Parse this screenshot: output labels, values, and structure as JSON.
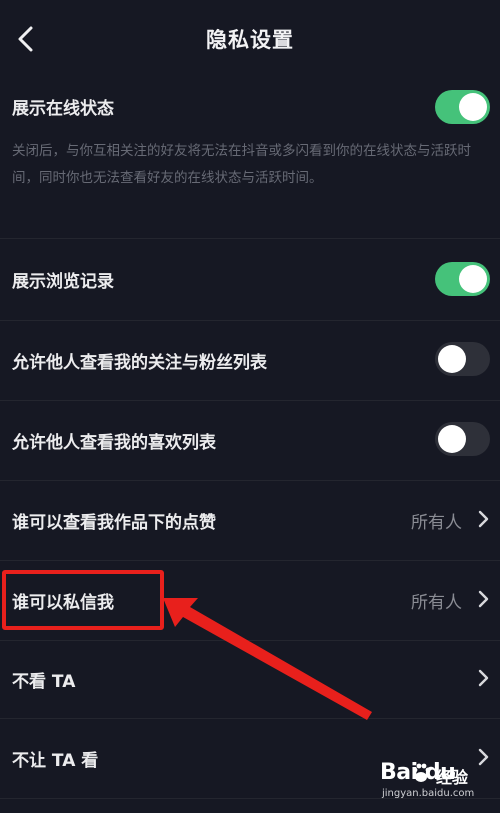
{
  "header": {
    "title": "隐私设置"
  },
  "rows": [
    {
      "label": "展示在线状态",
      "description": "关闭后，与你互相关注的好友将无法在抖音或多闪看到你的在线状态与活跃时间，同时你也无法查看好友的在线状态与活跃时间。",
      "toggle": true
    },
    {
      "label": "展示浏览记录",
      "toggle": true
    },
    {
      "label": "允许他人查看我的关注与粉丝列表",
      "toggle": false
    },
    {
      "label": "允许他人查看我的喜欢列表",
      "toggle": false
    },
    {
      "label": "谁可以查看我作品下的点赞",
      "value": "所有人"
    },
    {
      "label": "谁可以私信我",
      "value": "所有人"
    },
    {
      "label": "不看 TA"
    },
    {
      "label": "不让 TA 看"
    }
  ],
  "watermark": {
    "logo": "Bai  du",
    "brand": "经验",
    "url": "jingyan.baidu.com"
  },
  "colors": {
    "background": "#161823",
    "toggle_on": "#45c27a",
    "toggle_off": "#2e3039",
    "annotation": "#e8201c"
  }
}
